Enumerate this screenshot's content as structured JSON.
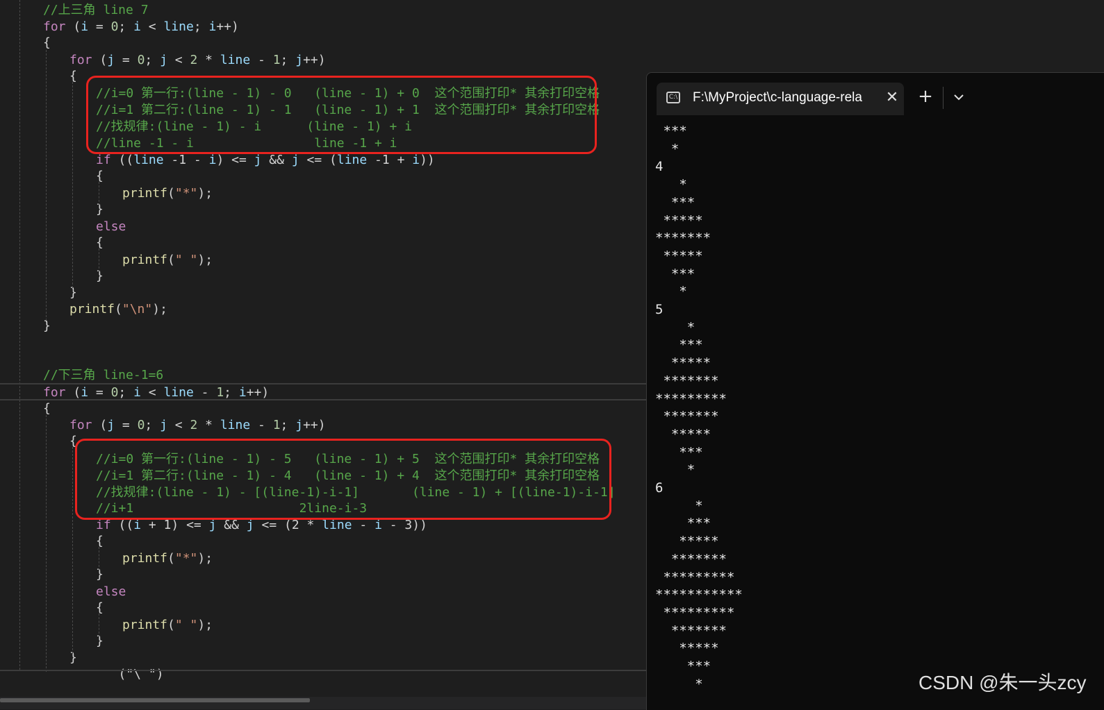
{
  "editor": {
    "lines": [
      {
        "parts": [
          {
            "t": "//上三角 line 7",
            "c": "cm"
          }
        ]
      },
      {
        "parts": [
          {
            "t": "for",
            "c": "kw"
          },
          {
            "t": " (",
            "c": "op"
          },
          {
            "t": "i",
            "c": "id"
          },
          {
            "t": " = ",
            "c": "op"
          },
          {
            "t": "0",
            "c": "num"
          },
          {
            "t": "; ",
            "c": "op"
          },
          {
            "t": "i",
            "c": "id"
          },
          {
            "t": " < ",
            "c": "op"
          },
          {
            "t": "line",
            "c": "id"
          },
          {
            "t": "; ",
            "c": "op"
          },
          {
            "t": "i",
            "c": "id"
          },
          {
            "t": "++)",
            "c": "op"
          }
        ]
      },
      {
        "parts": [
          {
            "t": "{",
            "c": "op"
          }
        ]
      },
      {
        "parts": [
          {
            "t": "for",
            "c": "kw"
          },
          {
            "t": " (",
            "c": "op"
          },
          {
            "t": "j",
            "c": "id"
          },
          {
            "t": " = ",
            "c": "op"
          },
          {
            "t": "0",
            "c": "num"
          },
          {
            "t": "; ",
            "c": "op"
          },
          {
            "t": "j",
            "c": "id"
          },
          {
            "t": " < ",
            "c": "op"
          },
          {
            "t": "2",
            "c": "num"
          },
          {
            "t": " * ",
            "c": "op"
          },
          {
            "t": "line",
            "c": "id"
          },
          {
            "t": " - ",
            "c": "op"
          },
          {
            "t": "1",
            "c": "num"
          },
          {
            "t": "; ",
            "c": "op"
          },
          {
            "t": "j",
            "c": "id"
          },
          {
            "t": "++)",
            "c": "op"
          }
        ]
      },
      {
        "parts": [
          {
            "t": "{",
            "c": "op"
          }
        ]
      },
      {
        "parts": [
          {
            "t": "//i=0 第一行:(line - 1) - 0   (line - 1) + 0  这个范围打印* 其余打印空格",
            "c": "cm"
          }
        ]
      },
      {
        "parts": [
          {
            "t": "//i=1 第二行:(line - 1) - 1   (line - 1) + 1  这个范围打印* 其余打印空格",
            "c": "cm"
          }
        ]
      },
      {
        "parts": [
          {
            "t": "//找规律:(line - 1) - i      (line - 1) + i",
            "c": "cm"
          }
        ]
      },
      {
        "parts": [
          {
            "t": "//line -1 - i                line -1 + i",
            "c": "cm"
          }
        ]
      },
      {
        "parts": [
          {
            "t": "if",
            "c": "kw"
          },
          {
            "t": " ((",
            "c": "op"
          },
          {
            "t": "line",
            "c": "id"
          },
          {
            "t": " -1 - ",
            "c": "op"
          },
          {
            "t": "i",
            "c": "id"
          },
          {
            "t": ") <= ",
            "c": "op"
          },
          {
            "t": "j",
            "c": "id"
          },
          {
            "t": " && ",
            "c": "op"
          },
          {
            "t": "j",
            "c": "id"
          },
          {
            "t": " <= (",
            "c": "op"
          },
          {
            "t": "line",
            "c": "id"
          },
          {
            "t": " -1 + ",
            "c": "op"
          },
          {
            "t": "i",
            "c": "id"
          },
          {
            "t": "))",
            "c": "op"
          }
        ]
      },
      {
        "parts": [
          {
            "t": "{",
            "c": "op"
          }
        ]
      },
      {
        "parts": [
          {
            "t": "printf",
            "c": "fn"
          },
          {
            "t": "(",
            "c": "op"
          },
          {
            "t": "\"*\"",
            "c": "str"
          },
          {
            "t": ");",
            "c": "op"
          }
        ]
      },
      {
        "parts": [
          {
            "t": "}",
            "c": "op"
          }
        ]
      },
      {
        "parts": [
          {
            "t": "else",
            "c": "kw"
          }
        ]
      },
      {
        "parts": [
          {
            "t": "{",
            "c": "op"
          }
        ]
      },
      {
        "parts": [
          {
            "t": "printf",
            "c": "fn"
          },
          {
            "t": "(",
            "c": "op"
          },
          {
            "t": "\" \"",
            "c": "str"
          },
          {
            "t": ");",
            "c": "op"
          }
        ]
      },
      {
        "parts": [
          {
            "t": "}",
            "c": "op"
          }
        ]
      },
      {
        "parts": [
          {
            "t": "}",
            "c": "op"
          }
        ]
      },
      {
        "parts": [
          {
            "t": "printf",
            "c": "fn"
          },
          {
            "t": "(",
            "c": "op"
          },
          {
            "t": "\"\\n\"",
            "c": "str"
          },
          {
            "t": ");",
            "c": "op"
          }
        ]
      },
      {
        "parts": [
          {
            "t": "}",
            "c": "op"
          }
        ]
      },
      {
        "parts": [
          {
            "t": "//下三角 line-1=6",
            "c": "cm"
          }
        ]
      },
      {
        "parts": [
          {
            "t": "for",
            "c": "kw"
          },
          {
            "t": " (",
            "c": "op"
          },
          {
            "t": "i",
            "c": "id"
          },
          {
            "t": " = ",
            "c": "op"
          },
          {
            "t": "0",
            "c": "num"
          },
          {
            "t": "; ",
            "c": "op"
          },
          {
            "t": "i",
            "c": "id"
          },
          {
            "t": " < ",
            "c": "op"
          },
          {
            "t": "line",
            "c": "id"
          },
          {
            "t": " - ",
            "c": "op"
          },
          {
            "t": "1",
            "c": "num"
          },
          {
            "t": "; ",
            "c": "op"
          },
          {
            "t": "i",
            "c": "id"
          },
          {
            "t": "++)",
            "c": "op"
          }
        ]
      },
      {
        "parts": [
          {
            "t": "{",
            "c": "op"
          }
        ]
      },
      {
        "parts": [
          {
            "t": "for",
            "c": "kw"
          },
          {
            "t": " (",
            "c": "op"
          },
          {
            "t": "j",
            "c": "id"
          },
          {
            "t": " = ",
            "c": "op"
          },
          {
            "t": "0",
            "c": "num"
          },
          {
            "t": "; ",
            "c": "op"
          },
          {
            "t": "j",
            "c": "id"
          },
          {
            "t": " < ",
            "c": "op"
          },
          {
            "t": "2",
            "c": "num"
          },
          {
            "t": " * ",
            "c": "op"
          },
          {
            "t": "line",
            "c": "id"
          },
          {
            "t": " - ",
            "c": "op"
          },
          {
            "t": "1",
            "c": "num"
          },
          {
            "t": "; ",
            "c": "op"
          },
          {
            "t": "j",
            "c": "id"
          },
          {
            "t": "++)",
            "c": "op"
          }
        ]
      },
      {
        "parts": [
          {
            "t": "{",
            "c": "op"
          }
        ]
      },
      {
        "parts": [
          {
            "t": "//i=0 第一行:(line - 1) - 5   (line - 1) + 5  这个范围打印* 其余打印空格",
            "c": "cm"
          }
        ]
      },
      {
        "parts": [
          {
            "t": "//i=1 第二行:(line - 1) - 4   (line - 1) + 4  这个范围打印* 其余打印空格",
            "c": "cm"
          }
        ]
      },
      {
        "parts": [
          {
            "t": "//找规律:(line - 1) - [(line-1)-i-1]       (line - 1) + [(line-1)-i-1]",
            "c": "cm"
          }
        ]
      },
      {
        "parts": [
          {
            "t": "//i+1                      2line-i-3",
            "c": "cm"
          }
        ]
      },
      {
        "parts": [
          {
            "t": "if",
            "c": "kw"
          },
          {
            "t": " ((",
            "c": "op"
          },
          {
            "t": "i",
            "c": "id"
          },
          {
            "t": " + 1) <= ",
            "c": "op"
          },
          {
            "t": "j",
            "c": "id"
          },
          {
            "t": " && ",
            "c": "op"
          },
          {
            "t": "j",
            "c": "id"
          },
          {
            "t": " <= (2 * ",
            "c": "op"
          },
          {
            "t": "line",
            "c": "id"
          },
          {
            "t": " - ",
            "c": "op"
          },
          {
            "t": "i",
            "c": "id"
          },
          {
            "t": " - 3))",
            "c": "op"
          }
        ]
      },
      {
        "parts": [
          {
            "t": "{",
            "c": "op"
          }
        ]
      },
      {
        "parts": [
          {
            "t": "printf",
            "c": "fn"
          },
          {
            "t": "(",
            "c": "op"
          },
          {
            "t": "\"*\"",
            "c": "str"
          },
          {
            "t": ");",
            "c": "op"
          }
        ]
      },
      {
        "parts": [
          {
            "t": "}",
            "c": "op"
          }
        ]
      },
      {
        "parts": [
          {
            "t": "else",
            "c": "kw"
          }
        ]
      },
      {
        "parts": [
          {
            "t": "{",
            "c": "op"
          }
        ]
      },
      {
        "parts": [
          {
            "t": "printf",
            "c": "fn"
          },
          {
            "t": "(",
            "c": "op"
          },
          {
            "t": "\" \"",
            "c": "str"
          },
          {
            "t": ");",
            "c": "op"
          }
        ]
      },
      {
        "parts": [
          {
            "t": "}",
            "c": "op"
          }
        ]
      },
      {
        "parts": [
          {
            "t": "}",
            "c": "op"
          }
        ]
      },
      {
        "parts": [
          {
            "t": "   (\"\\ \")",
            "c": "op"
          }
        ]
      }
    ]
  },
  "terminal": {
    "tab_title": "F:\\MyProject\\c-language-rela",
    "tab_icon": "terminal-icon",
    "tab_icon_text": "C:\\",
    "close_label": "✕",
    "new_tab_label": "+",
    "dropdown_icon": "chevron-down-icon",
    "output": " ***\n  *\n4\n   *\n  ***\n *****\n*******\n *****\n  ***\n   *\n5\n    *\n   ***\n  *****\n *******\n*********\n *******\n  *****\n   ***\n    *\n6\n     *\n    ***\n   *****\n  *******\n *********\n***********\n *********\n  *******\n   *****\n    ***\n     *"
  },
  "watermark": "CSDN @朱一头zcy"
}
